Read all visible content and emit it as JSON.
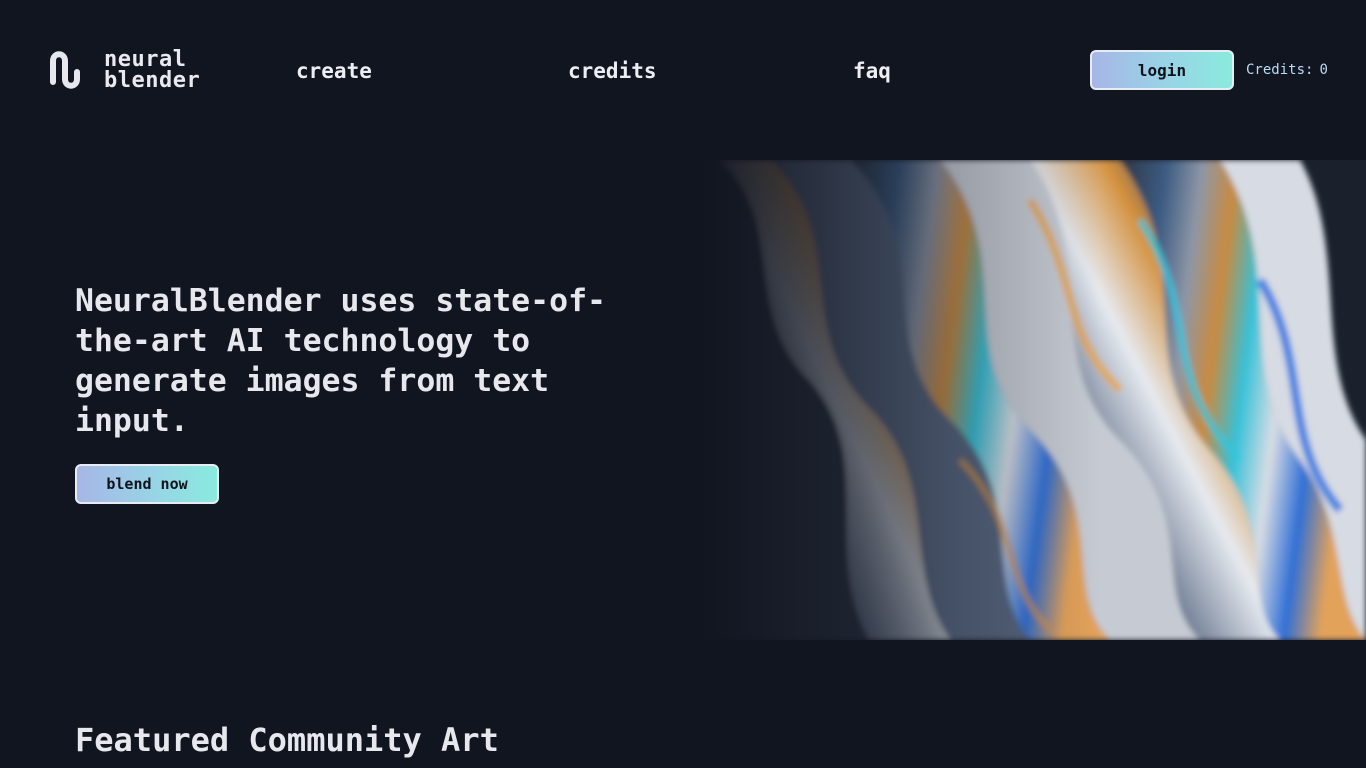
{
  "brand": {
    "name_line1": "neural",
    "name_line2": "blender"
  },
  "nav": {
    "create": "create",
    "credits": "credits",
    "faq": "faq"
  },
  "account": {
    "login_label": "login",
    "credits_label": "Credits:",
    "credits_value": "0"
  },
  "hero": {
    "heading": "NeuralBlender uses state-of-the-art AI technology to generate images from text input.",
    "cta_label": "blend now",
    "art_icon": "iridescent-fluid-artwork"
  },
  "featured": {
    "heading": "Featured Community Art"
  },
  "colors": {
    "background": "#111520",
    "button_gradient_start": "#a7b6e6",
    "button_gradient_end": "#8aeadd",
    "credits_text": "#b9dcf6"
  }
}
